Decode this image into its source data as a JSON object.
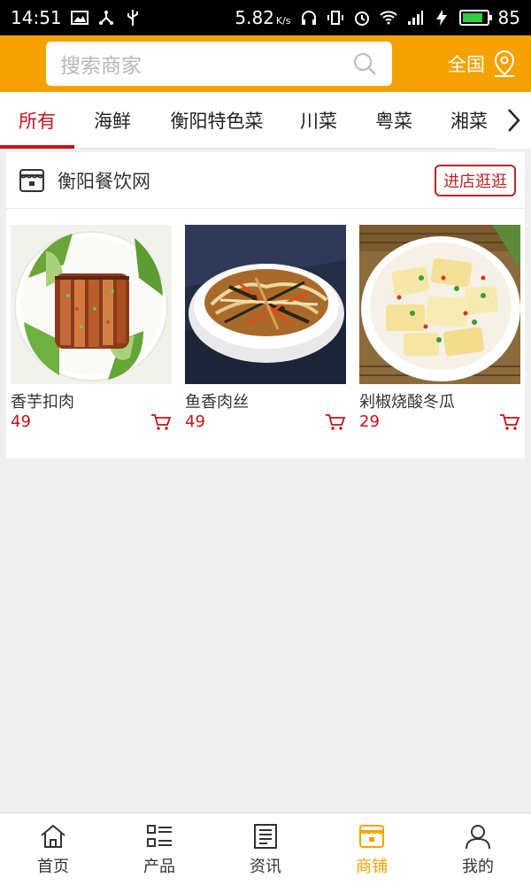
{
  "status_bar": {
    "time": "14:51",
    "net_speed": "5.82",
    "net_unit": "K/s",
    "battery_level": "85",
    "battery_fraction": 0.85
  },
  "header": {
    "search_placeholder": "搜索商家",
    "region_label": "全国"
  },
  "tabs": [
    {
      "label": "所有",
      "active": true
    },
    {
      "label": "海鲜"
    },
    {
      "label": "衡阳特色菜"
    },
    {
      "label": "川菜"
    },
    {
      "label": "粤菜"
    },
    {
      "label": "湘菜"
    }
  ],
  "store": {
    "name": "衡阳餐饮网",
    "visit_label": "进店逛逛",
    "products": [
      {
        "name": "香芋扣肉",
        "price": "49"
      },
      {
        "name": "鱼香肉丝",
        "price": "49"
      },
      {
        "name": "剁椒烧酸冬瓜",
        "price": "29"
      }
    ]
  },
  "bottom_nav": [
    {
      "label": "首页",
      "icon": "home-icon"
    },
    {
      "label": "产品",
      "icon": "list-icon"
    },
    {
      "label": "资讯",
      "icon": "news-icon"
    },
    {
      "label": "商铺",
      "icon": "shop-icon",
      "active": true
    },
    {
      "label": "我的",
      "icon": "user-icon"
    }
  ],
  "colors": {
    "accent": "#f5a200",
    "active_tab": "#c4121a",
    "price": "#c4121a"
  }
}
